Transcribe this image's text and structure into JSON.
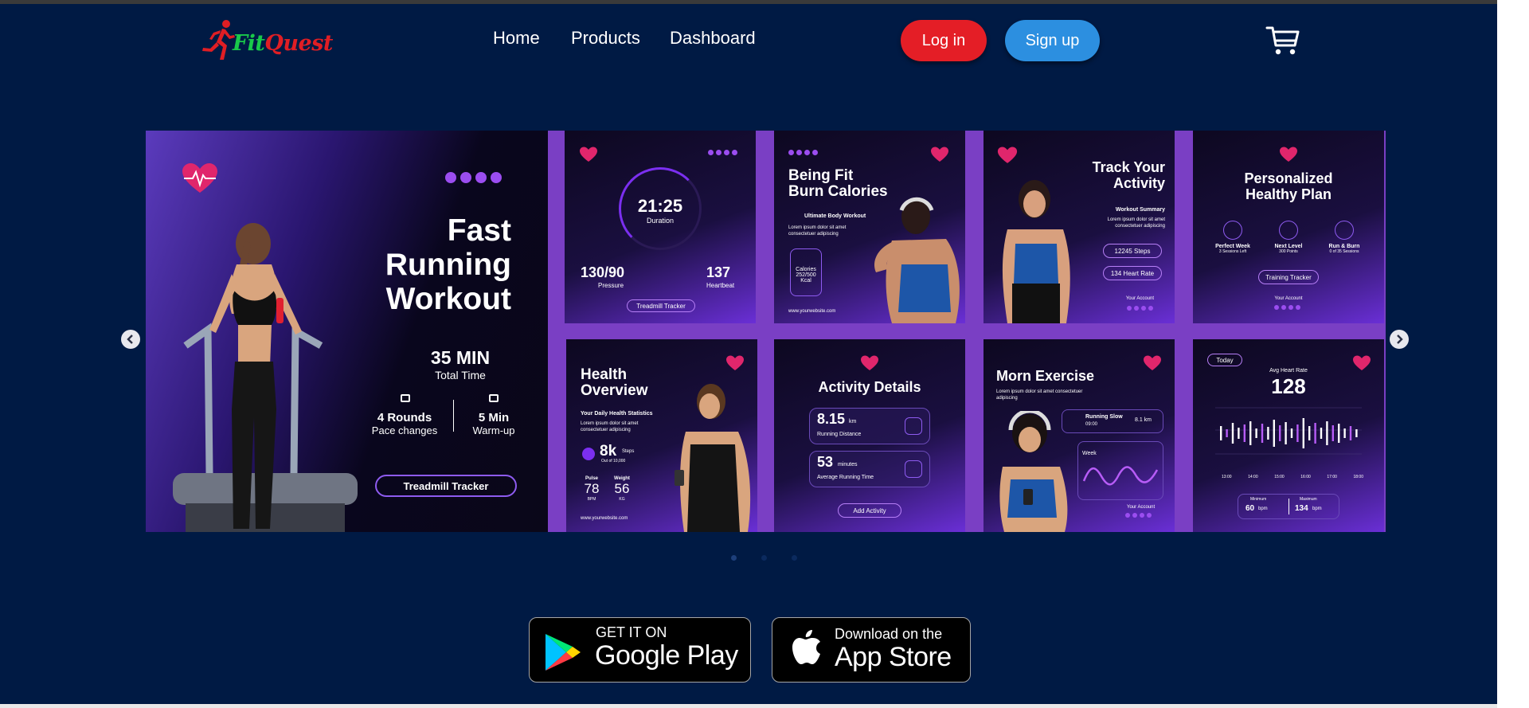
{
  "brand": {
    "name_part1": "Fit",
    "name_part2": "Quest",
    "color_fit": "#19c94a",
    "color_quest": "#e01e24"
  },
  "nav": {
    "links": [
      {
        "label": "Home"
      },
      {
        "label": "Products"
      },
      {
        "label": "Dashboard"
      }
    ]
  },
  "auth": {
    "login_label": "Log in",
    "signup_label": "Sign up"
  },
  "cart": {
    "icon": "cart-icon"
  },
  "carousel": {
    "active_index": 0,
    "dot_count": 3,
    "hero": {
      "title_line1": "Fast",
      "title_line2": "Running",
      "title_line3": "Workout",
      "total_time_value": "35 MIN",
      "total_time_label": "Total Time",
      "rounds_value": "4 Rounds",
      "rounds_label": "Pace changes",
      "warmup_value": "5 Min",
      "warmup_label": "Warm-up",
      "cta": "Treadmill Tracker"
    },
    "cards": {
      "duration": {
        "time": "21:25",
        "time_label": "Duration",
        "pressure": "130/90",
        "pressure_label": "Pressure",
        "heartbeat": "137",
        "heartbeat_label": "Heartbeat",
        "cta": "Treadmill Tracker"
      },
      "burn": {
        "title_line1": "Being Fit",
        "title_line2": "Burn Calories",
        "subtitle": "Ultimate Body Workout",
        "body": "Lorem ipsum dolor sit amet consectetuer adipiscing",
        "calories_label": "Calories",
        "calories_value": "252/500",
        "calories_unit": "Kcal",
        "website": "www.yourwebsite.com"
      },
      "track": {
        "title_line1": "Track Your",
        "title_line2": "Activity",
        "subtitle": "Workout Summary",
        "body": "Lorem ipsum dolor sit amet consectetuer adipiscing",
        "steps": "12245 Steps",
        "heart": "134 Heart Rate",
        "account": "Your Account"
      },
      "plan": {
        "title_line1": "Personalized",
        "title_line2": "Healthy Plan",
        "item1": "Perfect Week",
        "item1_sub": "3 Sessions Left",
        "item2": "Next Level",
        "item2_sub": "300 Points",
        "item3": "Run & Burn",
        "item3_sub": "0 of 35 Sessions",
        "cta": "Training Tracker",
        "account": "Your Account"
      },
      "overview": {
        "title_line1": "Health",
        "title_line2": "Overview",
        "subtitle": "Your Daily Health Statistics",
        "body": "Lorem ipsum dolor sit amet consectetuer adipiscing",
        "steps": "8k",
        "steps_unit": "Steps",
        "steps_sub": "Out of 10,000",
        "pulse_label": "Pulse",
        "pulse": "78",
        "pulse_unit": "BPM",
        "weight_label": "Weight",
        "weight": "56",
        "weight_unit": "KG",
        "website": "www.yourwebsite.com"
      },
      "activity": {
        "title": "Activity Details",
        "distance": "8.15",
        "distance_unit": "km",
        "distance_label": "Running Distance",
        "minutes": "53",
        "minutes_unit": "minutes",
        "minutes_label": "Average Running Time",
        "cta": "Add Activity"
      },
      "morn": {
        "title": "Morn Exercise",
        "body": "Lorem ipsum dolor sit amet consectetuer adipiscing",
        "run_label": "Running Slow",
        "run_value": "8.1 km",
        "run_sub": "09:00",
        "period": "Week",
        "account": "Your Account"
      },
      "heart": {
        "badge": "Today",
        "label": "Avg Heart Rate",
        "value": "128",
        "times": [
          "13:00",
          "14:00",
          "15:00",
          "16:00",
          "17:00",
          "18:00"
        ],
        "min_label": "Minimum",
        "min_value": "60",
        "max_label": "Maximum",
        "max_value": "134",
        "unit": "bpm"
      }
    }
  },
  "stores": {
    "google": {
      "small": "GET IT ON",
      "big": "Google Play"
    },
    "apple": {
      "small": "Download on the",
      "big": "App Store"
    }
  }
}
